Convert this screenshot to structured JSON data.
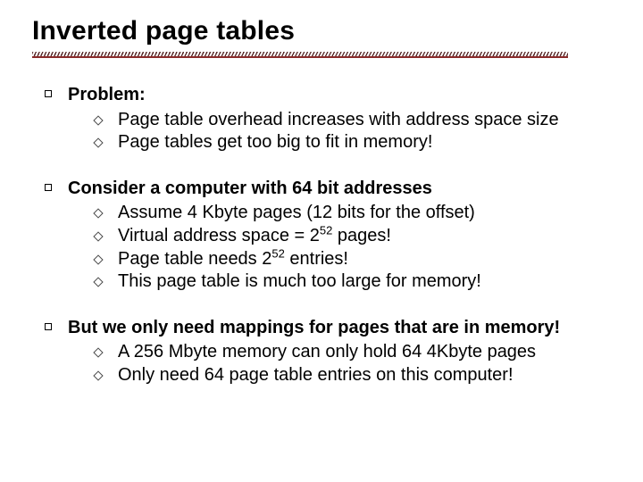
{
  "title": "Inverted page tables",
  "sections": [
    {
      "lead": "Problem:",
      "items": [
        {
          "text": "Page table overhead increases with address space size"
        },
        {
          "text": "Page tables get too big to fit in memory!"
        }
      ]
    },
    {
      "lead": "Consider a computer with 64 bit addresses",
      "items": [
        {
          "text": "Assume 4 Kbyte pages (12 bits for the offset)"
        },
        {
          "pre": "Virtual address space = 2",
          "sup": "52",
          "post": " pages!"
        },
        {
          "pre": "Page table needs 2",
          "sup": "52",
          "post": " entries!"
        },
        {
          "text": "This page table is much too large for memory!"
        }
      ]
    },
    {
      "lead": "But we only need mappings for pages that are in memory!",
      "items": [
        {
          "text": "A 256 Mbyte memory can only hold 64 4Kbyte pages"
        },
        {
          "text": "Only need 64 page table entries on this computer!"
        }
      ]
    }
  ]
}
